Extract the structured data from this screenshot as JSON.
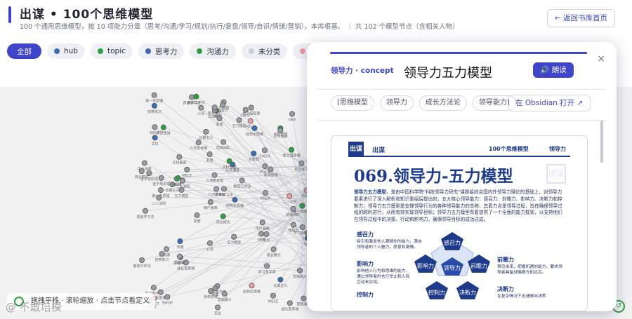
{
  "header": {
    "title": "出谋 • 100个思维模型",
    "subtitle": "100 个通用思维模型，按 10 项能力分章（思考/沟通/学习/规划/执行/复盘/领导/自识/情绪/营销）。本库根基。 ｜ 共 102 个模型节点（含相关人物）",
    "back_label": "← 返回书库首页"
  },
  "filters": [
    {
      "label": "全部",
      "color": ""
    },
    {
      "label": "hub",
      "color": "#3a6fb5"
    },
    {
      "label": "topic",
      "color": "#2f9e44"
    },
    {
      "label": "思考力",
      "color": "#4466aa"
    },
    {
      "label": "沟通力",
      "color": "#2f9e44"
    },
    {
      "label": "未分类",
      "color": "#cfcfd4"
    },
    {
      "label": "",
      "color": "#f09aa8"
    }
  ],
  "graph": {
    "hint": "拖拽平移 · 滚轮缩放 · 点击节点看定义",
    "watermark": "@ 不敢培模",
    "node_labels": [
      "商业模式",
      "五力模型",
      "学习金字塔",
      "复盘",
      "金字塔原理",
      "沟通",
      "结构化思维",
      "目标管理",
      "第一性原理",
      "长期主义",
      "反脆弱",
      "领导力",
      "认知偏差",
      "系统思维",
      "SWOT",
      "二八法则",
      "番茄工作法",
      "PDCA",
      "OKR",
      "心流",
      "刻意练习",
      "费曼学习法",
      "六顶思考帽",
      "情绪ABC",
      "成长型思维",
      "营销漏斗",
      "定位",
      "用户画像",
      "MECE",
      "5W2H"
    ]
  },
  "panel": {
    "breadcrumb": "领导力 · concept",
    "title": "领导力五力模型",
    "read_label": "🔊 朗读",
    "close_label": "×",
    "tags": [
      "[思维模型",
      "领导力",
      "成长方法论",
      "领导能力]"
    ],
    "obsidian_label": "在 Obsidian 打开 ↗",
    "doc": {
      "logo": "出谋",
      "brand": "出谋",
      "series": "100个思维模型",
      "section": "领导力",
      "title": "069.领导力-五力模型",
      "paragraph_lead": "领导力五力模型",
      "paragraph": "，是由中国科学院\"科技领导力研究\"课题组综合国内外领导力理论的基础上，对领导力要素进行了深入解析和知识重组后提出的，五大核心领导能力：感召力、前瞻力、影响力、决断力和控制力；领导力五力模型是支撑领导行为的各种领导能力的总称，其着力点是领导过程，旨在确保领导过程的顺利进行，从而有效实现领导目标；领导力五力模型有着提供了一个全面的能力框架，以支持他们在领导过程中的决策、行动和影响力，确保领导目标的成功达成。",
      "powers": [
        {
          "name": "感召力",
          "desc": "吸引和激发他人跟随你的能力，源自领导者的个人魅力、愿景和激情。"
        },
        {
          "name": "前瞻力",
          "desc": "预见未来，把握机遇的能力，要求领导者具备战略眼光和远见。"
        },
        {
          "name": "影响力",
          "desc": "影响他人行为和思维的能力，通过领导者的言行举止和人际互动来实现。"
        },
        {
          "name": "决断力",
          "desc": "在复杂情况下迅速做出决策"
        },
        {
          "name": "控制力",
          "desc": ""
        }
      ],
      "center": "领导力"
    }
  }
}
